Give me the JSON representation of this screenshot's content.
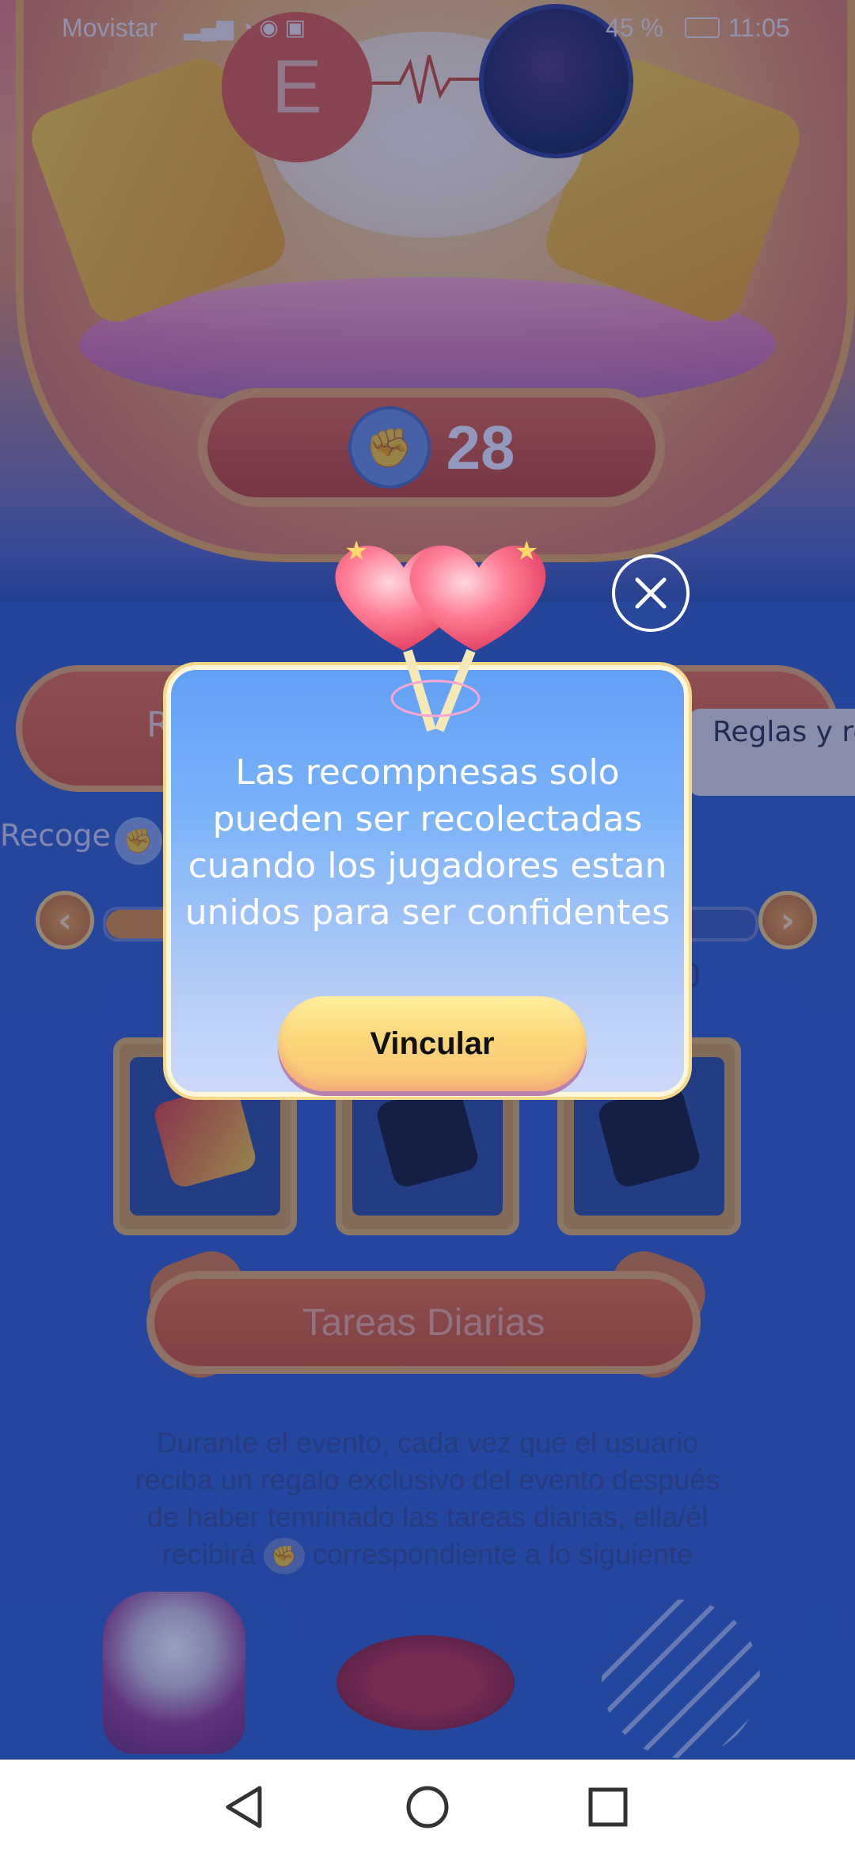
{
  "status_bar": {
    "carrier": "Movistar",
    "battery": "45 %",
    "time": "11:05"
  },
  "game": {
    "left_avatar_letter": "E",
    "score": "28",
    "bar_letter": "R",
    "rules_tab": "Reglas y recompensa",
    "collect_label": "Recoge",
    "progress_value": "0",
    "tasks_title": "Tareas Diarias",
    "tasks_description_1": "Durante el evento, cada vez que el usuario",
    "tasks_description_2": "reciba un regalo exclusivo del evento después",
    "tasks_description_3": "de haber temrinado las tareas diarias, ella/él",
    "tasks_description_4a": "recibirá",
    "tasks_description_4b": "correspondiente a lo siguiente"
  },
  "modal": {
    "message_lines": [
      "Las recompnesas solo",
      "pueden ser recolectadas",
      "cuando los jugadores estan",
      "unidos para ser confidentes"
    ],
    "action_label": "Vincular"
  },
  "colors": {
    "modal_top": "#62a0f7",
    "modal_bottom": "#cdd9fb",
    "button_yellow": "#fcd77a",
    "overlay": "#192d6e"
  },
  "icons": {
    "close": "close-icon",
    "back": "nav-back-icon",
    "home": "nav-home-icon",
    "recents": "nav-recents-icon",
    "decoration": "heart-lollipops-icon"
  }
}
